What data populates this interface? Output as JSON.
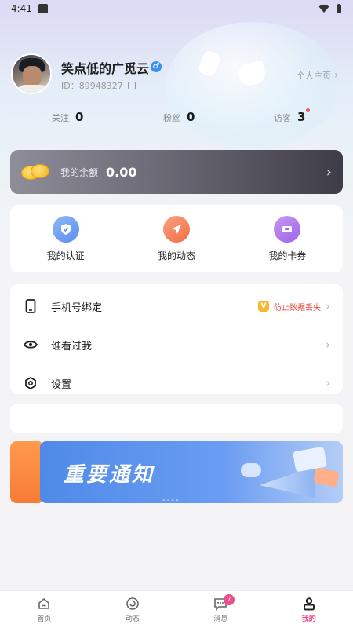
{
  "status_bar": {
    "time": "4:41"
  },
  "profile": {
    "username": "笑点低的广觅云",
    "uid": "ID：89948327",
    "homepage_link": "个人主页"
  },
  "stats": [
    {
      "label": "关注",
      "value": "0"
    },
    {
      "label": "粉丝",
      "value": "0"
    },
    {
      "label": "访客",
      "value": "3"
    }
  ],
  "balance": {
    "label": "我的余额",
    "value": "0.00"
  },
  "quick_actions": [
    {
      "label": "我的认证",
      "icon": "shield-icon"
    },
    {
      "label": "我的动态",
      "icon": "paper-plane-icon"
    },
    {
      "label": "我的卡券",
      "icon": "ticket-icon"
    }
  ],
  "menu": [
    {
      "label": "手机号绑定",
      "icon": "phone-icon",
      "badge": "V",
      "note": "防止数据丢失"
    },
    {
      "label": "谁看过我",
      "icon": "eye-icon"
    },
    {
      "label": "设置",
      "icon": "gear-icon"
    }
  ],
  "banner": {
    "title": "重要通知",
    "dots": "----"
  },
  "tabs": [
    {
      "label": "首页",
      "icon": "home-icon"
    },
    {
      "label": "动态",
      "icon": "refresh-icon"
    },
    {
      "label": "消息",
      "icon": "chat-icon",
      "badge": "7"
    },
    {
      "label": "我的",
      "icon": "user-icon"
    }
  ],
  "colors": {
    "accent": "#e6448a",
    "badge": "#ee4d8c",
    "warning": "#e8453c",
    "banner": "#5b8ef0"
  }
}
